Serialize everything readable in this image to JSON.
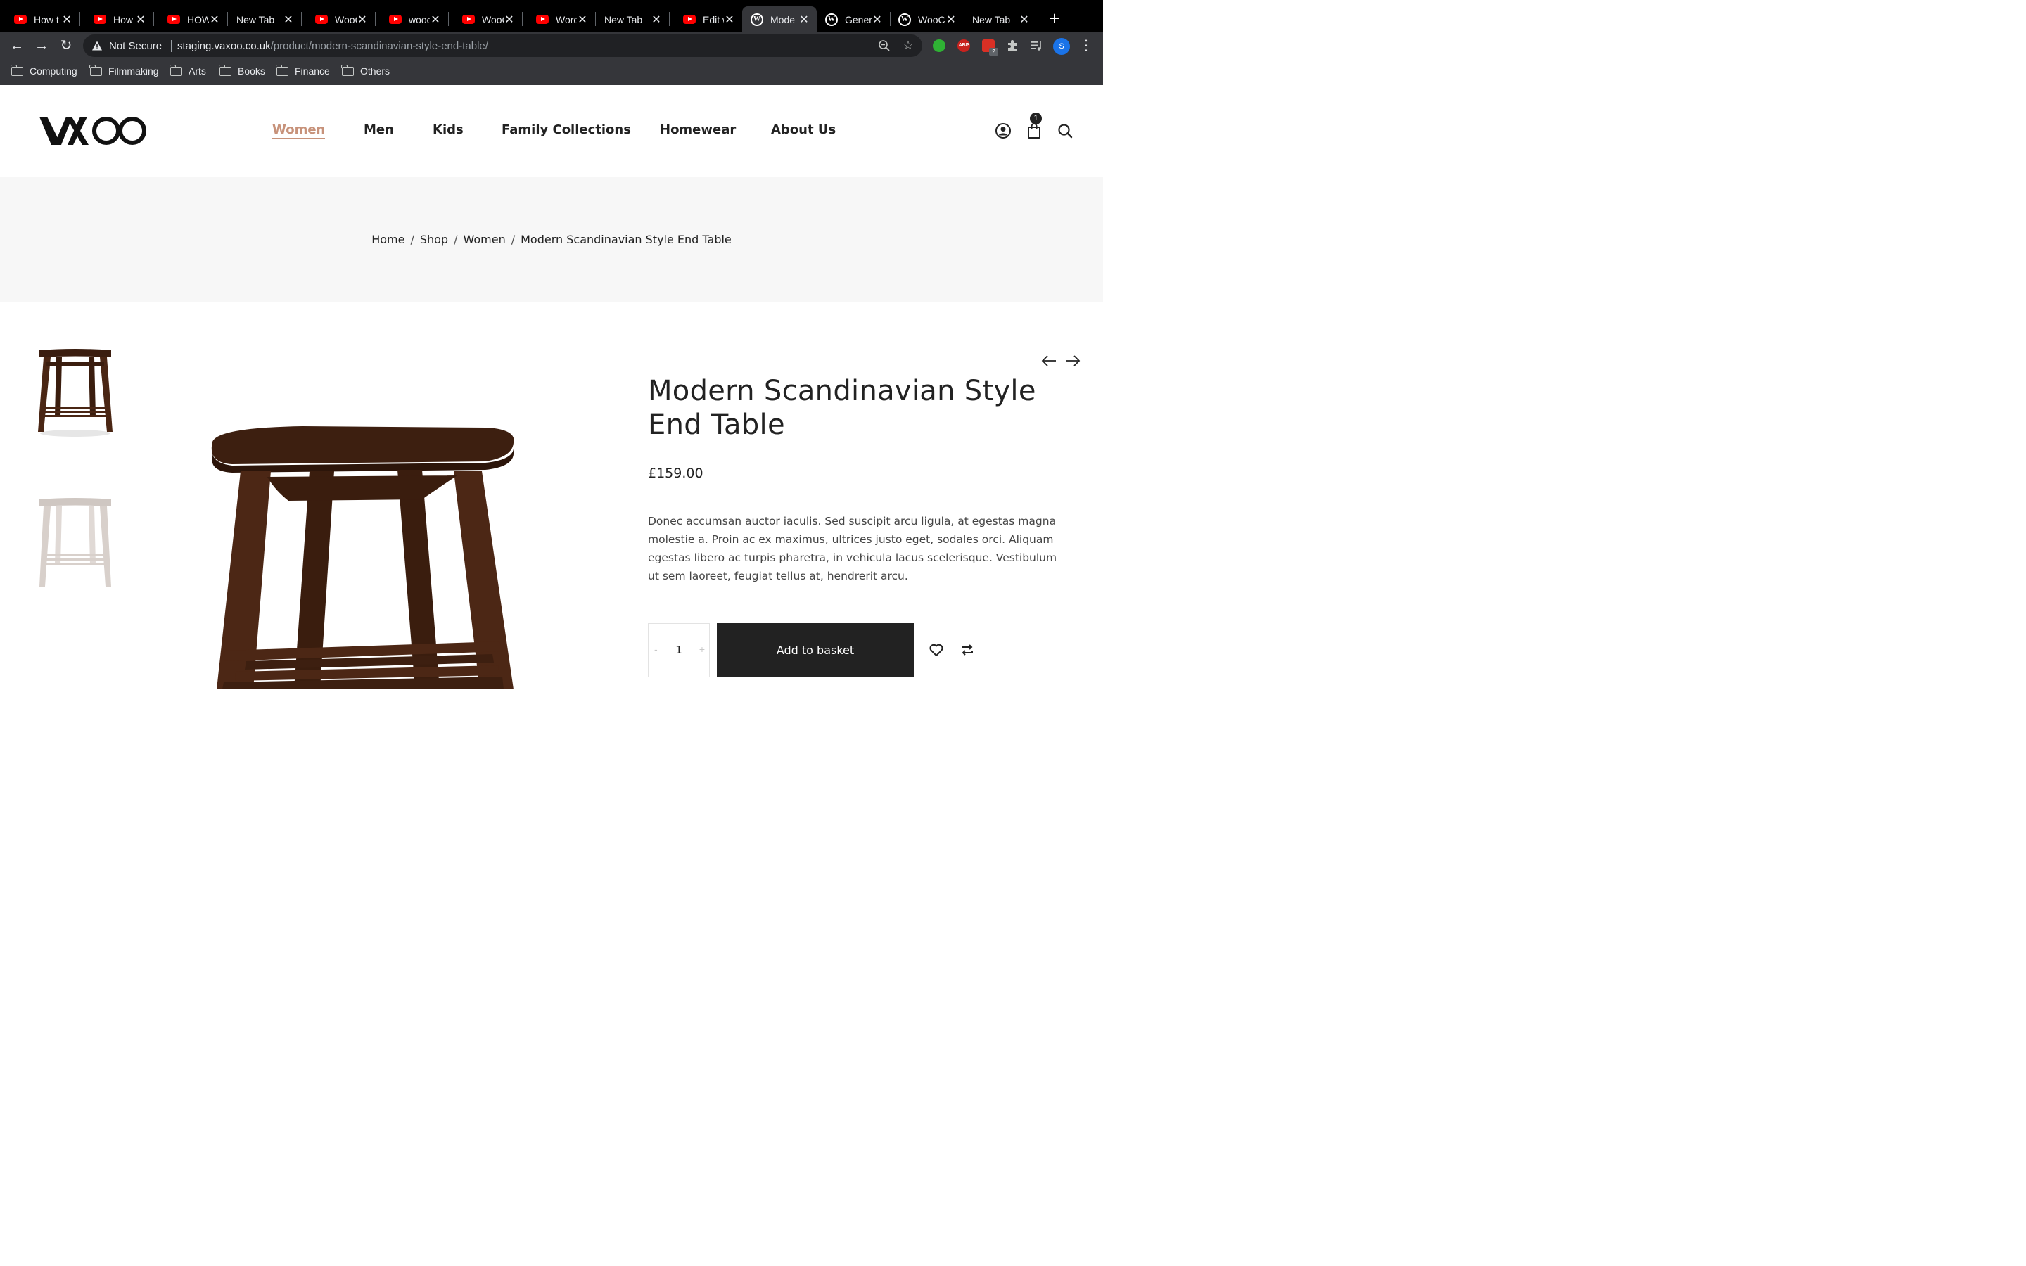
{
  "browser": {
    "tabs": [
      {
        "title": "How t",
        "favicon": "youtube-icon",
        "active": false
      },
      {
        "title": "How T",
        "favicon": "youtube-icon",
        "active": false
      },
      {
        "title": "HOW",
        "favicon": "youtube-icon",
        "active": false
      },
      {
        "title": "New Tab",
        "favicon": "none",
        "active": false
      },
      {
        "title": "WooC",
        "favicon": "youtube-icon",
        "active": false
      },
      {
        "title": "wooc",
        "favicon": "youtube-icon",
        "active": false
      },
      {
        "title": "WooC",
        "favicon": "youtube-icon",
        "active": false
      },
      {
        "title": "Word",
        "favicon": "youtube-icon",
        "active": false
      },
      {
        "title": "New Tab",
        "favicon": "none",
        "active": false
      },
      {
        "title": "Edit w",
        "favicon": "youtube-icon",
        "active": false
      },
      {
        "title": "Mode",
        "favicon": "wordpress-icon",
        "active": true
      },
      {
        "title": "Gener",
        "favicon": "wordpress-icon",
        "active": false
      },
      {
        "title": "WooC",
        "favicon": "wordpress-icon",
        "active": false
      },
      {
        "title": "New Tab",
        "favicon": "none",
        "active": false
      }
    ],
    "security_label": "Not Secure",
    "url_host": "staging.vaxoo.co.uk",
    "url_path": "/product/modern-scandinavian-style-end-table/",
    "extension_badge": "2",
    "profile_initial": "S",
    "bookmarks": [
      "Computing",
      "Filmmaking",
      "Arts",
      "Books",
      "Finance",
      "Others"
    ]
  },
  "site": {
    "logo_text": "VAXOO",
    "nav": [
      {
        "label": "Women",
        "active": true
      },
      {
        "label": "Men",
        "active": false
      },
      {
        "label": "Kids",
        "active": false
      },
      {
        "label": "Family Collections",
        "active": false
      },
      {
        "label": "Homewear",
        "active": false
      },
      {
        "label": "About Us",
        "active": false
      }
    ],
    "cart_count": "1",
    "accent_color": "#c7927a"
  },
  "breadcrumb": [
    "Home",
    "Shop",
    "Women",
    "Modern Scandinavian Style End Table"
  ],
  "breadcrumb_separator": "/",
  "product": {
    "title": "Modern Scandinavian Style End Table",
    "price": "£159.00",
    "description": "Donec accumsan auctor iaculis. Sed suscipit arcu ligula, at egestas magna molestie a. Proin ac ex maximus, ultrices justo eget, sodales orci. Aliquam egestas libero ac turpis pharetra, in vehicula lacus scelerisque. Vestibulum ut sem laoreet, feugiat tellus at, hendrerit arcu.",
    "quantity": "1",
    "qty_minus": "-",
    "qty_plus": "+",
    "add_to_basket_label": "Add to basket"
  }
}
